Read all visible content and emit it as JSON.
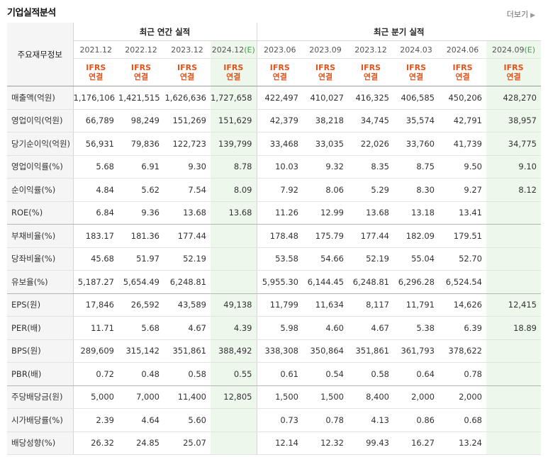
{
  "title": "기업실적분석",
  "more_label": "더보기",
  "header": {
    "row_label": "주요재무정보",
    "annual_group": "최근 연간 실적",
    "quarter_group": "최근 분기 실적",
    "annual_periods": [
      "2021.12",
      "2022.12",
      "2023.12",
      "2024.12"
    ],
    "annual_est_suffix": "(E)",
    "quarter_periods": [
      "2023.06",
      "2023.09",
      "2023.12",
      "2024.03",
      "2024.06",
      "2024.09"
    ],
    "quarter_est_suffix": "(E)",
    "ifrs_line1": "IFRS",
    "ifrs_line2": "연결"
  },
  "rows": [
    {
      "label": "매출액(억원)",
      "values": [
        "1,176,106",
        "1,421,515",
        "1,626,636",
        "1,727,658",
        "422,497",
        "410,027",
        "416,325",
        "406,585",
        "450,206",
        "428,270"
      ]
    },
    {
      "label": "영업이익(억원)",
      "values": [
        "66,789",
        "98,249",
        "151,269",
        "151,629",
        "42,379",
        "38,218",
        "34,745",
        "35,574",
        "42,791",
        "38,957"
      ]
    },
    {
      "label": "당기순이익(억원)",
      "values": [
        "56,931",
        "79,836",
        "122,723",
        "139,799",
        "33,468",
        "33,035",
        "22,026",
        "33,760",
        "41,739",
        "34,775"
      ]
    },
    {
      "label": "영업이익률(%)",
      "values": [
        "5.68",
        "6.91",
        "9.30",
        "8.78",
        "10.03",
        "9.32",
        "8.35",
        "8.75",
        "9.50",
        "9.10"
      ]
    },
    {
      "label": "순이익률(%)",
      "values": [
        "4.84",
        "5.62",
        "7.54",
        "8.09",
        "7.92",
        "8.06",
        "5.29",
        "8.30",
        "9.27",
        "8.12"
      ]
    },
    {
      "label": "ROE(%)",
      "values": [
        "6.84",
        "9.36",
        "13.68",
        "13.68",
        "11.26",
        "12.99",
        "13.68",
        "13.18",
        "13.41",
        ""
      ]
    },
    {
      "label": "부채비율(%)",
      "values": [
        "183.17",
        "181.36",
        "177.44",
        "",
        "178.48",
        "175.79",
        "177.44",
        "182.09",
        "179.51",
        ""
      ]
    },
    {
      "label": "당좌비율(%)",
      "values": [
        "45.68",
        "51.97",
        "52.19",
        "",
        "53.58",
        "54.66",
        "52.19",
        "55.04",
        "52.70",
        ""
      ]
    },
    {
      "label": "유보율(%)",
      "values": [
        "5,187.27",
        "5,654.49",
        "6,248.81",
        "",
        "5,955.30",
        "6,144.45",
        "6,248.81",
        "6,296.28",
        "6,524.54",
        ""
      ]
    },
    {
      "label": "EPS(원)",
      "values": [
        "17,846",
        "26,592",
        "43,589",
        "49,138",
        "11,799",
        "11,634",
        "8,117",
        "11,791",
        "14,626",
        "12,415"
      ]
    },
    {
      "label": "PER(배)",
      "values": [
        "11.71",
        "5.68",
        "4.67",
        "4.39",
        "5.98",
        "4.60",
        "4.67",
        "5.38",
        "6.39",
        "18.89"
      ]
    },
    {
      "label": "BPS(원)",
      "values": [
        "289,609",
        "315,142",
        "351,861",
        "388,492",
        "338,308",
        "350,864",
        "351,861",
        "361,793",
        "378,622",
        ""
      ]
    },
    {
      "label": "PBR(배)",
      "values": [
        "0.72",
        "0.48",
        "0.58",
        "0.55",
        "0.61",
        "0.54",
        "0.58",
        "0.64",
        "0.78",
        ""
      ]
    },
    {
      "label": "주당배당금(원)",
      "values": [
        "5,000",
        "7,000",
        "11,400",
        "12,805",
        "1,500",
        "1,500",
        "8,400",
        "2,000",
        "2,000",
        ""
      ]
    },
    {
      "label": "시가배당률(%)",
      "values": [
        "2.39",
        "4.64",
        "5.60",
        "",
        "0.73",
        "0.78",
        "4.13",
        "0.86",
        "0.68",
        ""
      ]
    },
    {
      "label": "배당성향(%)",
      "values": [
        "26.32",
        "24.85",
        "25.07",
        "",
        "12.14",
        "12.32",
        "99.43",
        "16.27",
        "13.24",
        ""
      ]
    }
  ],
  "group_end_rows": [
    5,
    8,
    12
  ],
  "colors": {
    "ifrs": "#e0541b",
    "estimate_bg": "#edf7ec",
    "estimate_mark": "#3fa046",
    "label_bg": "#f5f5f5"
  }
}
